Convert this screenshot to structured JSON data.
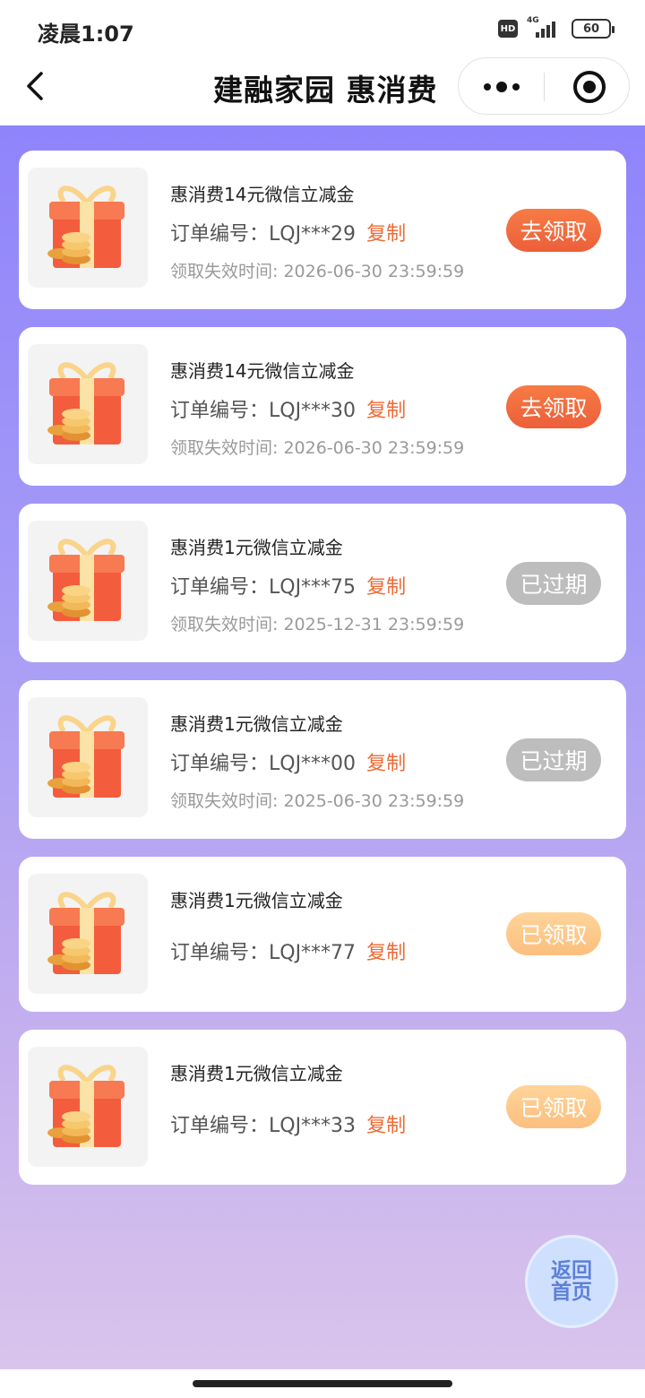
{
  "status_bar": {
    "time": "凌晨1:07",
    "hd_badge": "HD",
    "network": "4G",
    "battery": "60"
  },
  "nav": {
    "title": "建融家园 惠消费",
    "back_icon": "chevron-left-icon",
    "more_icon": "more-dots-icon",
    "close_icon": "target-circle-icon"
  },
  "order_label_prefix": "订单编号：",
  "copy_label": "复制",
  "colors": {
    "active_button": "#ec5f3a",
    "expired_button": "#bdbdbd",
    "claimed_button": "#fbbf7e",
    "copy_link": "#ee6a35",
    "background_top": "#8f84fb",
    "background_bottom": "#d9c4ec"
  },
  "items": [
    {
      "title": "惠消费14元微信立减金",
      "order_label": "订单编号：LQJ***29",
      "copy": "复制",
      "expire": "领取失效时间: 2026-06-30 23:59:59",
      "button": "去领取",
      "status": "active"
    },
    {
      "title": "惠消费14元微信立减金",
      "order_label": "订单编号：LQJ***30",
      "copy": "复制",
      "expire": "领取失效时间: 2026-06-30 23:59:59",
      "button": "去领取",
      "status": "active"
    },
    {
      "title": "惠消费1元微信立减金",
      "order_label": "订单编号：LQJ***75",
      "copy": "复制",
      "expire": "领取失效时间: 2025-12-31 23:59:59",
      "button": "已过期",
      "status": "expired"
    },
    {
      "title": "惠消费1元微信立减金",
      "order_label": "订单编号：LQJ***00",
      "copy": "复制",
      "expire": "领取失效时间: 2025-06-30 23:59:59",
      "button": "已过期",
      "status": "expired"
    },
    {
      "title": "惠消费1元微信立减金",
      "order_label": "订单编号：LQJ***77",
      "copy": "复制",
      "button": "已领取",
      "status": "claimed"
    },
    {
      "title": "惠消费1元微信立减金",
      "order_label": "订单编号：LQJ***33",
      "copy": "复制",
      "button": "已领取",
      "status": "claimed"
    }
  ],
  "home_button": "返回首页"
}
